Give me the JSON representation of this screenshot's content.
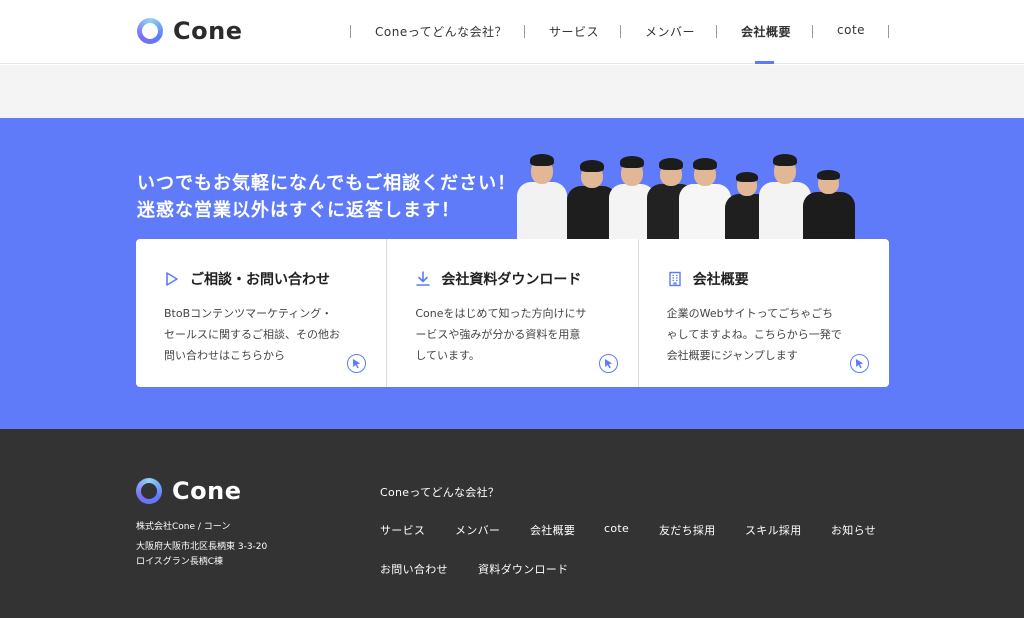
{
  "header": {
    "logo_text": "Cone",
    "nav": [
      {
        "label": "Coneってどんな会社？",
        "active": false
      },
      {
        "label": "サービス",
        "active": false
      },
      {
        "label": "メンバー",
        "active": false
      },
      {
        "label": "会社概要",
        "active": true
      },
      {
        "label": "cote",
        "active": false
      }
    ]
  },
  "cta": {
    "heading_line1": "いつでもお気軽になんでもご相談ください！",
    "heading_line2": "迷惑な営業以外はすぐに返答します！",
    "cards": [
      {
        "title": "ご相談・お問い合わせ",
        "icon": "play-triangle-icon",
        "desc": [
          "BtoBコンテンツマーケティング・",
          "セールスに関するご相談、その他お",
          "問い合わせはこちらから"
        ]
      },
      {
        "title": "会社資料ダウンロード",
        "icon": "download-icon",
        "desc": [
          "Coneをはじめて知った方向けにサ",
          "ービスや強みが分かる資料を用意",
          "しています。"
        ]
      },
      {
        "title": "会社概要",
        "icon": "building-icon",
        "desc": [
          "企業のWebサイトってごちゃごち",
          "ゃしてますよね。こちらから一発で",
          "会社概要にジャンプします"
        ]
      }
    ]
  },
  "footer": {
    "logo_text": "Cone",
    "company": "株式会社Cone / コーン",
    "address_line1": "大阪府大阪市北区長柄東 3-3-20",
    "address_line2": "ロイスグラン長柄C棟",
    "links_row1": [
      "Coneってどんな会社？"
    ],
    "links_row2": [
      "サービス",
      "メンバー",
      "会社概要",
      "cote",
      "友だち採用",
      "スキル採用",
      "お知らせ"
    ],
    "links_row3": [
      "お問い合わせ",
      "資料ダウンロード"
    ]
  },
  "colors": {
    "accent": "#5b7cfa",
    "cta_background": "#5f7bfa",
    "footer_background": "#333333"
  }
}
